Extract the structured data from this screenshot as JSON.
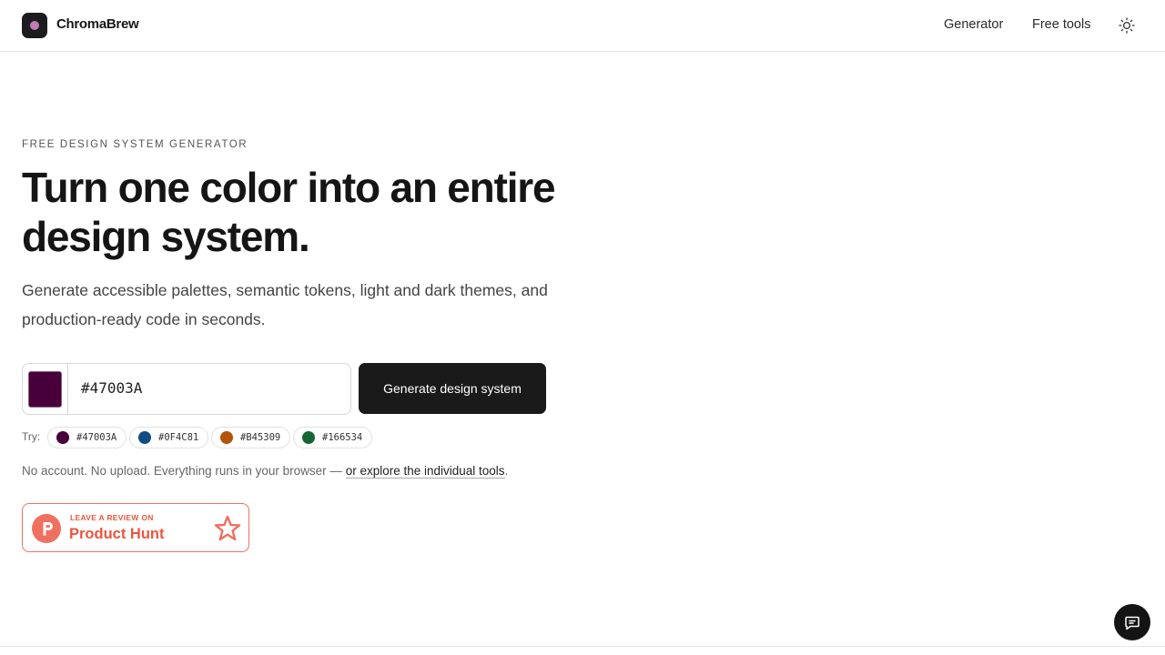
{
  "header": {
    "brand": "ChromaBrew",
    "nav": [
      {
        "label": "Generator"
      },
      {
        "label": "Free tools"
      }
    ],
    "icons": {
      "logo": "brand-logo-icon",
      "theme": "sun-icon"
    },
    "logo_dot_color": "#c07bb6"
  },
  "hero": {
    "eyebrow": "FREE DESIGN SYSTEM GENERATOR",
    "headline": "Turn one color into an entire design system.",
    "subtitle": "Generate accessible palettes, semantic tokens, light and dark themes, and production-ready code in seconds."
  },
  "generator": {
    "input_value": "#47003A",
    "swatch_color": "#47003A",
    "button_label": "Generate design system"
  },
  "presets": {
    "label": "Try:",
    "chips": [
      {
        "label": "#47003A",
        "color": "#47003A"
      },
      {
        "label": "#0F4C81",
        "color": "#0F4C81"
      },
      {
        "label": "#B45309",
        "color": "#B45309"
      },
      {
        "label": "#166534",
        "color": "#166534"
      }
    ]
  },
  "note": {
    "text": "No account. No upload. Everything runs in your browser — ",
    "link": "or explore the individual tools",
    "end": "."
  },
  "product_hunt": {
    "small": "LEAVE A REVIEW ON",
    "big": "Product Hunt",
    "color": "#f0705f"
  },
  "chat": {
    "icon": "chat-bubble-icon"
  }
}
